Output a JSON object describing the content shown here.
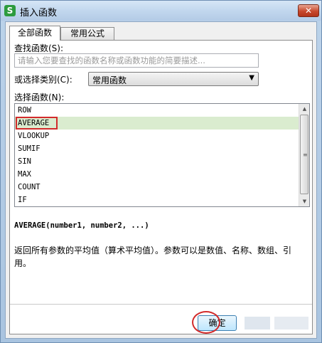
{
  "window": {
    "app_icon": "S",
    "title": "插入函数",
    "close_label": "✕"
  },
  "tabs": [
    {
      "label": "全部函数",
      "active": true
    },
    {
      "label": "常用公式",
      "active": false
    }
  ],
  "search": {
    "label": "查找函数(S):",
    "placeholder": "请输入您要查找的函数名称或函数功能的简要描述..."
  },
  "category": {
    "label": "或选择类别(C):",
    "value": "常用函数"
  },
  "function_list": {
    "label": "选择函数(N):",
    "items": [
      "ROW",
      "AVERAGE",
      "VLOOKUP",
      "SUMIF",
      "SIN",
      "MAX",
      "COUNT",
      "IF"
    ],
    "selected_index": 1
  },
  "syntax": "AVERAGE(number1, number2, ...)",
  "description": "返回所有参数的平均值（算术平均值）。参数可以是数值、名称、数组、引用。",
  "buttons": {
    "ok_label": "确定"
  },
  "colors": {
    "selection": "#daeccf",
    "annotation_red": "#d22b2b",
    "titlebar": "#c2d7ee"
  }
}
